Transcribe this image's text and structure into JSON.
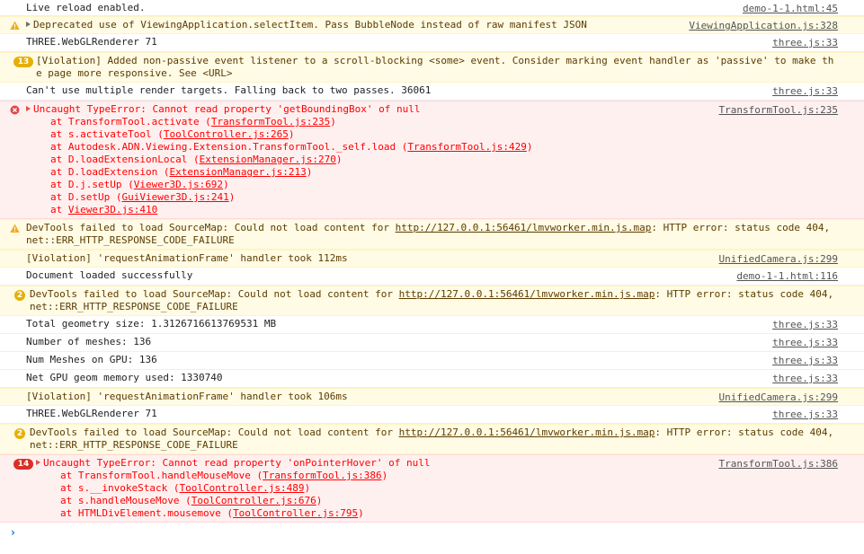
{
  "colors": {
    "warning_bg": "#fffbe5",
    "error_bg": "#fff0f0",
    "error_text": "#ff0000",
    "warning_text": "#5c3c00",
    "prompt_chevron": "#1a73e8"
  },
  "messages": [
    {
      "level": "info",
      "text": "Live reload enabled.",
      "source": "demo-1-1.html:45"
    },
    {
      "level": "warn",
      "icon": "warning-icon",
      "expandable": true,
      "text": "Deprecated use of ViewingApplication.selectItem. Pass BubbleNode instead of raw manifest JSON",
      "source": "ViewingApplication.js:328"
    },
    {
      "level": "info",
      "text": "THREE.WebGLRenderer 71",
      "source": "three.js:33"
    },
    {
      "level": "warn",
      "badge": "13",
      "text": "[Violation] Added non-passive event listener to a scroll-blocking <some> event. Consider marking event handler as 'passive' to make the page more responsive. See <URL>",
      "source": ""
    },
    {
      "level": "info",
      "text": "Can't use multiple render targets. Falling back to two passes. 36061",
      "source": "three.js:33"
    },
    {
      "level": "err",
      "icon": "error-icon",
      "expandable": true,
      "text": "Uncaught TypeError: Cannot read property 'getBoundingBox' of null",
      "source": "TransformTool.js:235",
      "stack": [
        {
          "pre": "at TransformTool.activate (",
          "link": "TransformTool.js:235",
          "post": ")"
        },
        {
          "pre": "at s.activateTool (",
          "link": "ToolController.js:265",
          "post": ")"
        },
        {
          "pre": "at Autodesk.ADN.Viewing.Extension.TransformTool._self.load (",
          "link": "TransformTool.js:429",
          "post": ")"
        },
        {
          "pre": "at D.loadExtensionLocal (",
          "link": "ExtensionManager.js:270",
          "post": ")"
        },
        {
          "pre": "at D.loadExtension (",
          "link": "ExtensionManager.js:213",
          "post": ")"
        },
        {
          "pre": "at D.j.setUp (",
          "link": "Viewer3D.js:692",
          "post": ")"
        },
        {
          "pre": "at D.setUp (",
          "link": "GuiViewer3D.js:241",
          "post": ")"
        },
        {
          "pre": "at ",
          "link": "Viewer3D.js:410",
          "post": ""
        }
      ]
    },
    {
      "level": "warn",
      "icon": "warning-icon",
      "text_pre": "DevTools failed to load SourceMap: Could not load content for ",
      "link": "http://127.0.0.1:56461/lmvworker.min.js.map",
      "text_post": ": HTTP error: status code 404, net::ERR_HTTP_RESPONSE_CODE_FAILURE",
      "source": ""
    },
    {
      "level": "warn",
      "text": "[Violation] 'requestAnimationFrame' handler took 112ms",
      "source": "UnifiedCamera.js:299"
    },
    {
      "level": "info",
      "text": "Document loaded successfully",
      "source": "demo-1-1.html:116"
    },
    {
      "level": "warn",
      "badge": "2",
      "text_pre": "DevTools failed to load SourceMap: Could not load content for ",
      "link": "http://127.0.0.1:56461/lmvworker.min.js.map",
      "text_post": ": HTTP error: status code 404, net::ERR_HTTP_RESPONSE_CODE_FAILURE",
      "source": ""
    },
    {
      "level": "info",
      "text": "Total geometry size: 1.3126716613769531 MB",
      "source": "three.js:33"
    },
    {
      "level": "info",
      "text": "Number of meshes: 136",
      "source": "three.js:33"
    },
    {
      "level": "info",
      "text": "Num Meshes on GPU: 136",
      "source": "three.js:33"
    },
    {
      "level": "info",
      "text": "Net GPU geom memory used: 1330740",
      "source": "three.js:33"
    },
    {
      "level": "warn",
      "text": "[Violation] 'requestAnimationFrame' handler took 106ms",
      "source": "UnifiedCamera.js:299"
    },
    {
      "level": "info",
      "text": "THREE.WebGLRenderer 71",
      "source": "three.js:33"
    },
    {
      "level": "warn",
      "badge": "2",
      "text_pre": "DevTools failed to load SourceMap: Could not load content for ",
      "link": "http://127.0.0.1:56461/lmvworker.min.js.map",
      "text_post": ": HTTP error: status code 404, net::ERR_HTTP_RESPONSE_CODE_FAILURE",
      "source": ""
    },
    {
      "level": "err",
      "badge": "14",
      "expandable": true,
      "text": "Uncaught TypeError: Cannot read property 'onPointerHover' of null",
      "source": "TransformTool.js:386",
      "stack": [
        {
          "pre": "at TransformTool.handleMouseMove (",
          "link": "TransformTool.js:386",
          "post": ")"
        },
        {
          "pre": "at s.__invokeStack (",
          "link": "ToolController.js:489",
          "post": ")"
        },
        {
          "pre": "at s.handleMouseMove (",
          "link": "ToolController.js:676",
          "post": ")"
        },
        {
          "pre": "at HTMLDivElement.mousemove (",
          "link": "ToolController.js:795",
          "post": ")"
        }
      ]
    }
  ],
  "prompt": {
    "chevron": "›",
    "value": ""
  }
}
